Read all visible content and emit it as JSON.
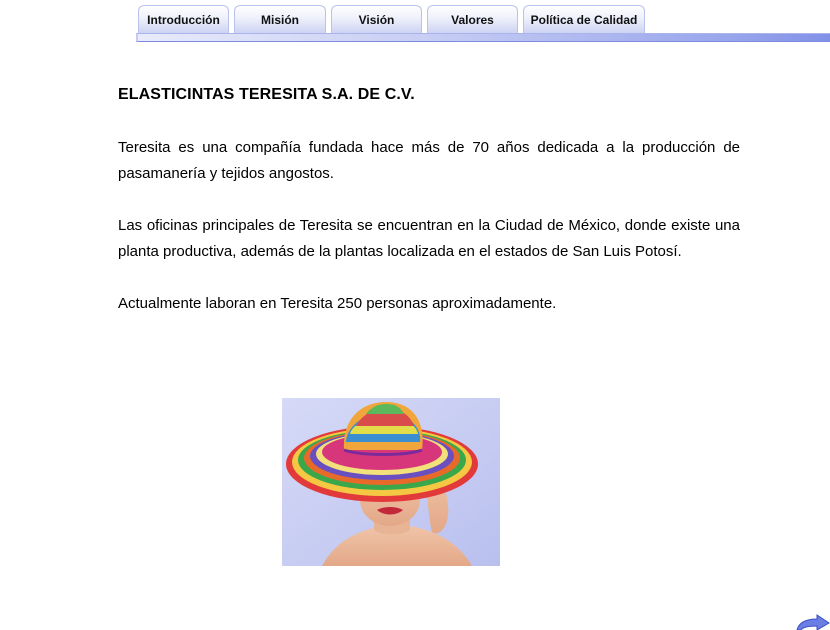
{
  "nav": {
    "tabs": [
      {
        "label": "Introducción"
      },
      {
        "label": "Misión"
      },
      {
        "label": "Visión"
      },
      {
        "label": "Valores"
      },
      {
        "label": "Política de Calidad"
      }
    ]
  },
  "main": {
    "title": "ELASTICINTAS TERESITA S.A. DE C.V.",
    "paragraphs": [
      "Teresita es una compañía fundada hace más de 70 años dedicada a la producción de pasamanería y tejidos angostos.",
      "Las oficinas principales de Teresita se encuentran en la Ciudad de México, donde existe una planta productiva, además de la plantas localizada en el estados de San Luis Potosí.",
      "Actualmente laboran en Teresita 250 personas aproximadamente."
    ]
  },
  "colors": {
    "tab_border": "#b9c2ea",
    "tab_bar_gradient_end": "#8291e8",
    "photo_background": "#c7cdf2",
    "arrow": "#5b6fe0"
  },
  "icons": {
    "next_page": "right-arrow-icon"
  }
}
